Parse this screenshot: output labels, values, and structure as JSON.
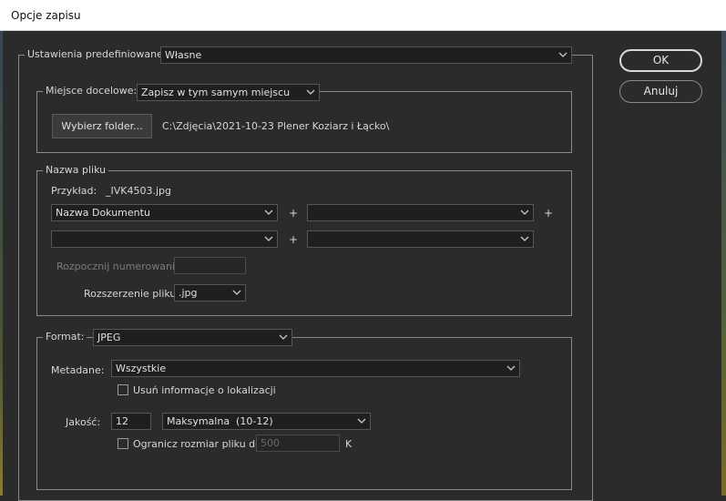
{
  "window": {
    "title": "Opcje zapisu"
  },
  "presets": {
    "label": "Ustawienia predefiniowane:",
    "value": "Własne"
  },
  "buttons": {
    "ok": "OK",
    "cancel": "Anuluj"
  },
  "destination": {
    "label": "Miejsce docelowe:",
    "value": "Zapisz w tym samym miejscu",
    "choose_folder": "Wybierz folder...",
    "path": "C:\\Zdjęcia\\2021-10-23 Plener Koziarz i Łącko\\"
  },
  "file_naming": {
    "legend": "Nazwa pliku",
    "example_label": "Przykład:",
    "example_value": "_IVK4503.jpg",
    "row1": {
      "field1": "Nazwa Dokumentu",
      "field2": ""
    },
    "row2": {
      "field1": "",
      "field2": ""
    },
    "plus": "+",
    "start_numbering_label": "Rozpocznij numerowanie:",
    "start_numbering_value": "",
    "extension_label": "Rozszerzenie pliku:",
    "extension_value": ".jpg"
  },
  "format": {
    "label": "Format:",
    "value": "JPEG",
    "metadata_label": "Metadane:",
    "metadata_value": "Wszystkie",
    "remove_location_label": "Usuń informacje o lokalizacji",
    "quality_label": "Jakość:",
    "quality_value": "12",
    "quality_level": "Maksymalna  (10-12)",
    "limit_size_label": "Ogranicz rozmiar pliku do:",
    "limit_size_value": "500",
    "limit_size_unit": "K"
  },
  "icons": {
    "dropdown": "chevron-down-icon"
  }
}
